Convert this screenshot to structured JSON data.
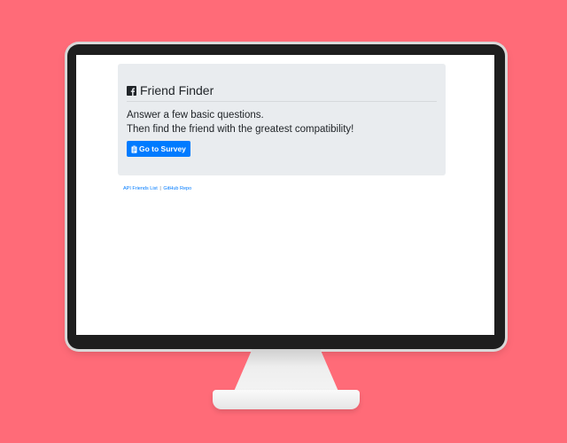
{
  "page": {
    "title": "Friend Finder",
    "lead_line1": "Answer a few basic questions.",
    "lead_line2": "Then find the friend with the greatest compatibility!",
    "survey_button_label": "Go to Survey"
  },
  "footer": {
    "api_link_label": "API Friends List",
    "separator": "|",
    "github_link_label": "GitHub Repo"
  },
  "icons": {
    "title_icon": "facebook-icon",
    "button_icon": "clipboard-icon"
  },
  "colors": {
    "background": "#ff6b78",
    "jumbotron": "#e9ecef",
    "primary": "#007bff",
    "link": "#007bff"
  }
}
